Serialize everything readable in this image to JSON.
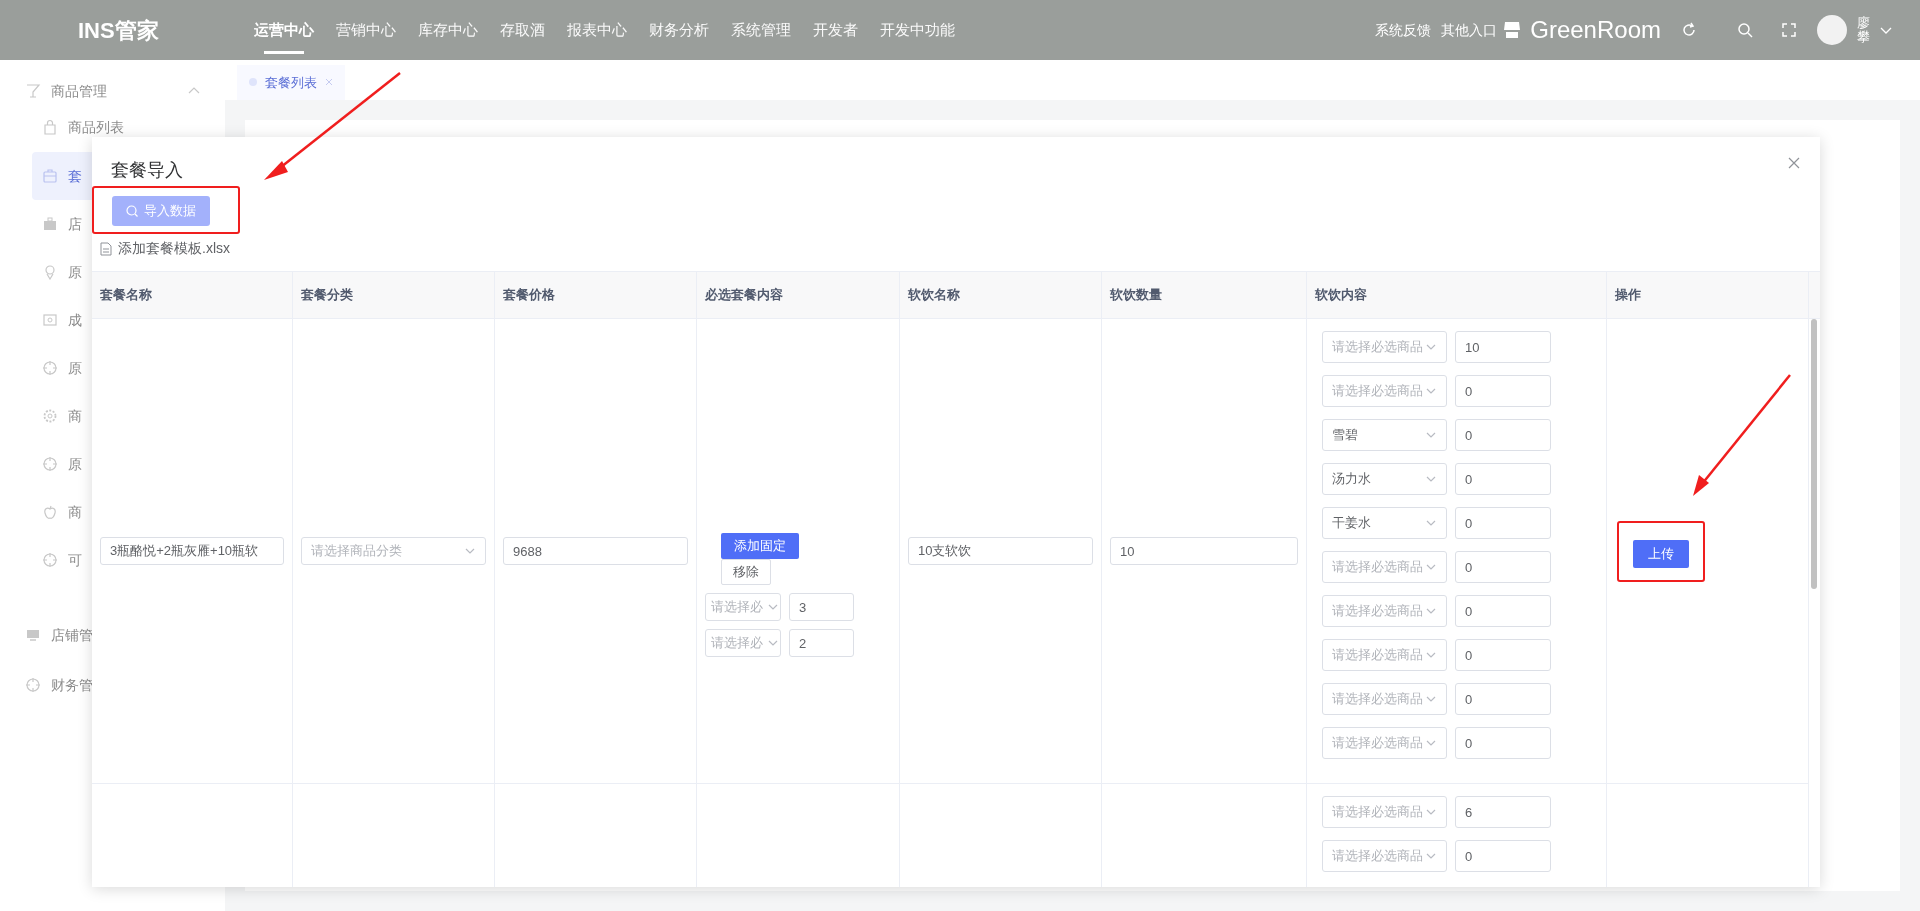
{
  "header": {
    "logo": "INS管家",
    "nav": [
      {
        "label": "运营中心",
        "selected": true
      },
      {
        "label": "营销中心",
        "selected": false
      },
      {
        "label": "库存中心",
        "selected": false
      },
      {
        "label": "存取酒",
        "selected": false
      },
      {
        "label": "报表中心",
        "selected": false
      },
      {
        "label": "财务分析",
        "selected": false
      },
      {
        "label": "系统管理",
        "selected": false
      },
      {
        "label": "开发者",
        "selected": false
      },
      {
        "label": "开发中功能",
        "selected": false
      }
    ],
    "links": [
      "系统反馈",
      "其他入口"
    ],
    "store_name": "GreenRoom",
    "user_name": "廖攀"
  },
  "sidebar": {
    "groups": [
      {
        "label": "商品管理",
        "items": [
          {
            "label": "商品列表",
            "selected": false
          },
          {
            "label": "套",
            "selected": true
          },
          {
            "label": "店",
            "selected": false
          },
          {
            "label": "原",
            "selected": false
          },
          {
            "label": "成",
            "selected": false
          },
          {
            "label": "原",
            "selected": false
          },
          {
            "label": "商",
            "selected": false
          },
          {
            "label": "原",
            "selected": false
          },
          {
            "label": "商",
            "selected": false
          },
          {
            "label": "可",
            "selected": false
          }
        ]
      },
      {
        "label": "店铺管"
      },
      {
        "label": "财务管"
      }
    ]
  },
  "tabs": [
    {
      "label": "套餐列表",
      "selected": true
    }
  ],
  "modal": {
    "title": "套餐导入",
    "import_button": "导入数据",
    "template_file": "添加套餐模板.xlsx",
    "table": {
      "columns": [
        "套餐名称",
        "套餐分类",
        "套餐价格",
        "必选套餐内容",
        "软饮名称",
        "软饮数量",
        "软饮内容",
        "操作"
      ],
      "rows": [
        {
          "name": "3瓶酪悦+2瓶灰雁+10瓶软",
          "category_placeholder": "请选择商品分类",
          "price": "9688",
          "add_button": "添加固定",
          "remove_button": "移除",
          "required_items": [
            {
              "placeholder": "请选择必",
              "quantity": "3"
            },
            {
              "placeholder": "请选择必",
              "quantity": "2"
            }
          ],
          "drink_name": "10支软饮",
          "drink_count": "10",
          "drinks": [
            {
              "placeholder": "请选择必选商品",
              "quantity": "10"
            },
            {
              "placeholder": "请选择必选商品",
              "quantity": "0"
            },
            {
              "value": "雪碧",
              "quantity": "0"
            },
            {
              "value": "汤力水",
              "quantity": "0"
            },
            {
              "value": "干姜水",
              "quantity": "0"
            },
            {
              "placeholder": "请选择必选商品",
              "quantity": "0"
            },
            {
              "placeholder": "请选择必选商品",
              "quantity": "0"
            },
            {
              "placeholder": "请选择必选商品",
              "quantity": "0"
            },
            {
              "placeholder": "请选择必选商品",
              "quantity": "0"
            },
            {
              "placeholder": "请选择必选商品",
              "quantity": "0"
            }
          ],
          "action_button": "上传"
        },
        {
          "drinks": [
            {
              "placeholder": "请选择必选商品",
              "quantity": "6"
            },
            {
              "placeholder": "请选择必选商品",
              "quantity": "0"
            }
          ]
        }
      ]
    }
  }
}
